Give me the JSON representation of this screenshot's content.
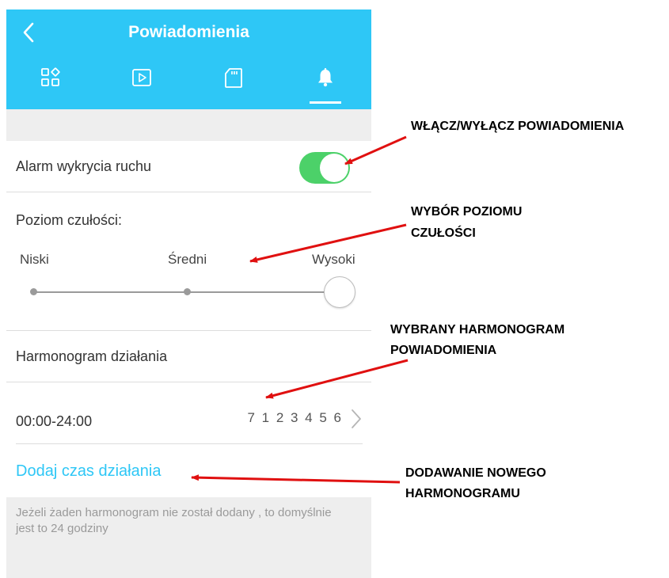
{
  "header": {
    "title": "Powiadomienia",
    "back_icon": "chevron-left-icon",
    "tabs": [
      {
        "icon": "apps-grid-icon"
      },
      {
        "icon": "play-video-icon"
      },
      {
        "icon": "sd-card-icon"
      },
      {
        "icon": "bell-icon",
        "active": true
      }
    ],
    "color": "#2ec7f6"
  },
  "motion_alarm": {
    "label": "Alarm wykrycia ruchu",
    "enabled": true,
    "toggle_color": "#4cd169"
  },
  "sensitivity": {
    "label": "Poziom czułości:",
    "levels": [
      "Niski",
      "Średni",
      "Wysoki"
    ],
    "selected": "Wysoki"
  },
  "schedule": {
    "label": "Harmonogram działania",
    "items": [
      {
        "time": "00:00-24:00",
        "days": "7 1 2 3 4 5 6"
      }
    ],
    "add_label": "Dodaj czas działania",
    "note": "Jeżeli żaden harmonogram nie został dodany , to domyślnie jest to 24 godziny"
  },
  "annotations": {
    "toggle": "WŁĄCZ/WYŁĄCZ POWIADOMIENIA",
    "sensitivity_line1": "WYBÓR POZIOMU",
    "sensitivity_line2": "CZUŁOŚCI",
    "schedule_line1": "WYBRANY HARMONOGRAM",
    "schedule_line2": "POWIADOMIENIA",
    "add_line1": "DODAWANIE  NOWEGO",
    "add_line2": "HARMONOGRAMU",
    "arrow_color": "#e01010"
  }
}
